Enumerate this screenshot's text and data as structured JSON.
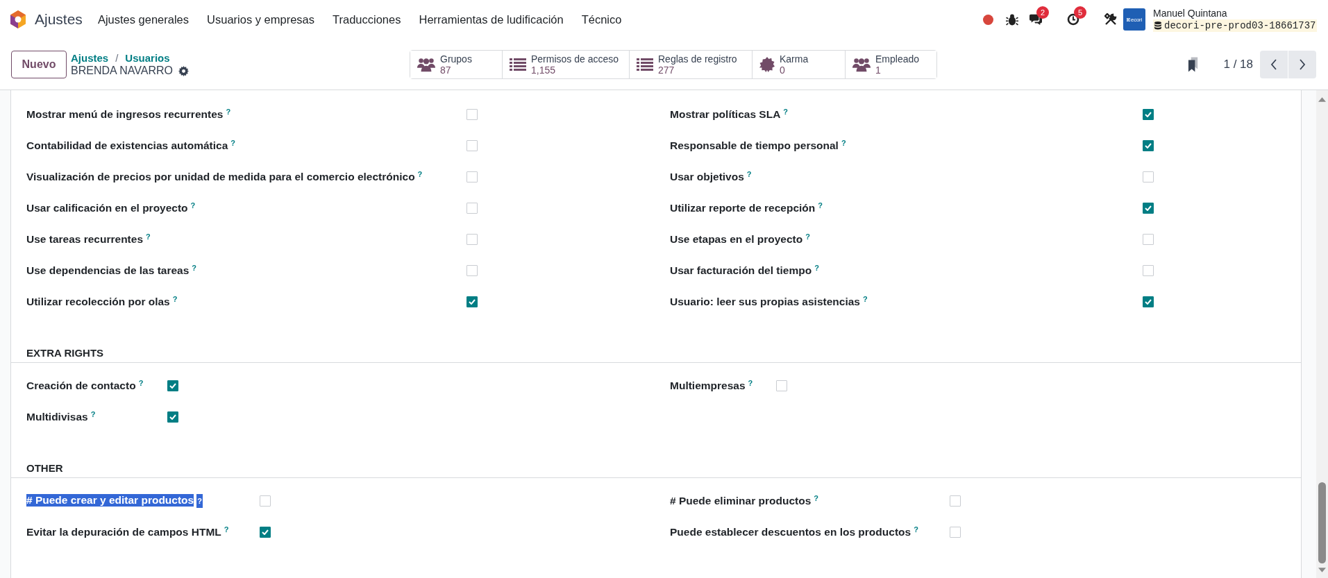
{
  "navbar": {
    "app_name": "Ajustes",
    "menu": [
      "Ajustes generales",
      "Usuarios y empresas",
      "Traducciones",
      "Herramientas de ludificación",
      "Técnico"
    ],
    "systray": {
      "chat_count": "2",
      "activity_count": "5"
    },
    "user": {
      "name": "Manuel Quintana",
      "database": "decori-pre-prod03-18661737",
      "avatar_text": "ecori"
    }
  },
  "control_panel": {
    "new_button": "Nuevo",
    "breadcrumbs": [
      "Ajustes",
      "Usuarios"
    ],
    "breadcrumb_separator": "/",
    "record_title": "BRENDA NAVARRO",
    "smart_buttons": [
      {
        "kind": "users",
        "label": "Grupos",
        "value": "87"
      },
      {
        "kind": "list",
        "label": "Permisos de acceso",
        "value": "1,155"
      },
      {
        "kind": "list",
        "label": "Reglas de registro",
        "value": "277"
      },
      {
        "kind": "seal",
        "label": "Karma",
        "value": "0"
      },
      {
        "kind": "users",
        "label": "Empleado",
        "value": "1"
      }
    ],
    "pager": "1 / 18"
  },
  "sections": [
    {
      "left": [
        {
          "label": "Mostrar menú de ingresos recurrentes",
          "tooltip": "?",
          "checked": false,
          "highlighted": false
        },
        {
          "label": "Contabilidad de existencias automática",
          "tooltip": "?",
          "checked": false,
          "highlighted": false
        },
        {
          "label": "Visualización de precios por unidad de medida para el comercio electrónico",
          "tooltip": "?",
          "checked": false,
          "highlighted": false
        },
        {
          "label": "Usar calificación en el proyecto",
          "tooltip": "?",
          "checked": false,
          "highlighted": false
        },
        {
          "label": "Use tareas recurrentes",
          "tooltip": "?",
          "checked": false,
          "highlighted": false
        },
        {
          "label": "Use dependencias de las tareas",
          "tooltip": "?",
          "checked": false,
          "highlighted": false
        },
        {
          "label": "Utilizar recolección por olas",
          "tooltip": "?",
          "checked": true,
          "highlighted": false
        }
      ],
      "right": [
        {
          "label": "Mostrar políticas SLA",
          "tooltip": "?",
          "checked": true,
          "highlighted": false
        },
        {
          "label": "Responsable de tiempo personal",
          "tooltip": "?",
          "checked": true,
          "highlighted": false
        },
        {
          "label": "Usar objetivos",
          "tooltip": "?",
          "checked": false,
          "highlighted": false
        },
        {
          "label": "Utilizar reporte de recepción",
          "tooltip": "?",
          "checked": true,
          "highlighted": false
        },
        {
          "label": "Use etapas en el proyecto",
          "tooltip": "?",
          "checked": false,
          "highlighted": false
        },
        {
          "label": "Usar facturación del tiempo",
          "tooltip": "?",
          "checked": false,
          "highlighted": false
        },
        {
          "label": "Usuario: leer sus propias asistencias",
          "tooltip": "?",
          "checked": true,
          "highlighted": false
        }
      ]
    },
    {
      "title": "EXTRA RIGHTS",
      "left": [
        {
          "label": "Creación de contacto",
          "tooltip": "?",
          "checked": true,
          "highlighted": false
        },
        {
          "label": "Multidivisas",
          "tooltip": "?",
          "checked": true,
          "highlighted": false
        }
      ],
      "right": [
        {
          "label": "Multiempresas",
          "tooltip": "?",
          "checked": false,
          "highlighted": false
        }
      ]
    },
    {
      "title": "OTHER",
      "left": [
        {
          "label": "# Puede crear y editar productos",
          "tooltip": "?",
          "checked": false,
          "highlighted": true
        },
        {
          "label": "Evitar la depuración de campos HTML",
          "tooltip": "?",
          "checked": true,
          "highlighted": false
        }
      ],
      "right": [
        {
          "label": "# Puede eliminar productos",
          "tooltip": "?",
          "checked": false,
          "highlighted": false
        },
        {
          "label": "Puede establecer descuentos en los productos",
          "tooltip": "?",
          "checked": false,
          "highlighted": false
        }
      ]
    }
  ]
}
